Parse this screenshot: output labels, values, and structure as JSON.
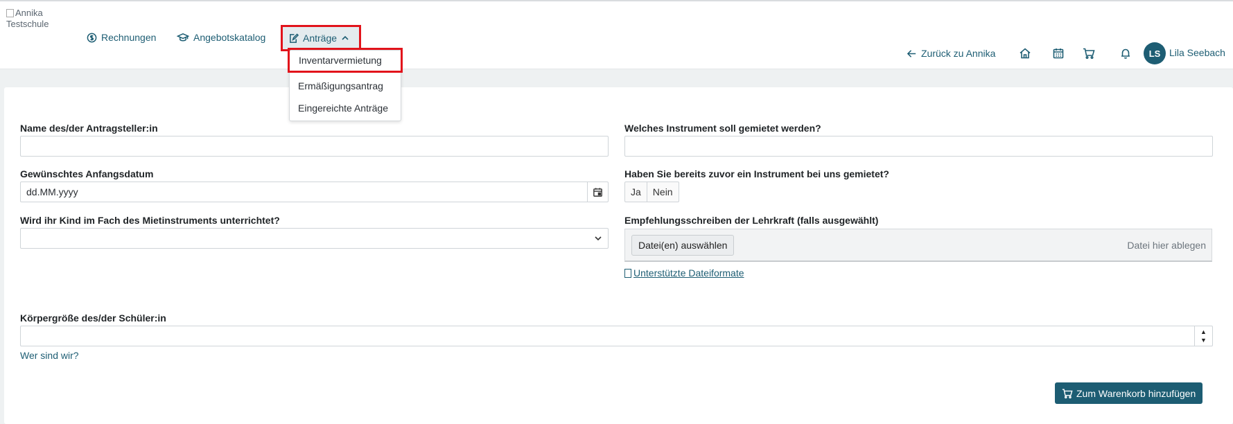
{
  "header": {
    "logo_alt": "Annika Testschule",
    "nav": [
      {
        "label": "Rechnungen",
        "icon": "dollar-circle-icon"
      },
      {
        "label": "Angebotskatalog",
        "icon": "graduation-cap-icon"
      },
      {
        "label": "Anträge",
        "icon": "edit-document-icon",
        "expanded": true
      }
    ],
    "back_label": "Zurück zu Annika",
    "icons": [
      "home-icon",
      "calendar-icon",
      "cart-icon",
      "bell-icon"
    ],
    "user": {
      "initials": "LS",
      "name": "Lila Seebach"
    }
  },
  "dropdown": {
    "items": [
      {
        "label": "Inventarvermietung",
        "selected": true
      },
      {
        "label": "Ermäßigungsantrag"
      },
      {
        "label": "Eingereichte Anträge"
      }
    ]
  },
  "form": {
    "name_label": "Name des/der Antragsteller:in",
    "name_value": "",
    "instrument_label": "Welches Instrument soll gemietet werden?",
    "instrument_value": "",
    "start_date_label": "Gewünschtes Anfangsdatum",
    "start_date_placeholder": "dd.MM.yyyy",
    "rented_before_label": "Haben Sie bereits zuvor ein Instrument bei uns gemietet?",
    "yes": "Ja",
    "no": "Nein",
    "taught_label": "Wird ihr Kind im Fach des Mietinstruments unterrichtet?",
    "taught_value": "",
    "recommendation_label": "Empfehlungsschreiben der Lehrkraft (falls ausgewählt)",
    "choose_files": "Datei(en) auswählen",
    "drop_hint": "Datei hier ablegen",
    "supported_formats": "Unterstützte Dateiformate",
    "height_label": "Körpergröße des/der Schüler:in",
    "height_value": "",
    "about_link": "Wer sind wir?",
    "add_to_cart": "Zum Warenkorb hinzufügen"
  },
  "colors": {
    "primary": "#1d5d73",
    "highlight": "#e2131b",
    "background": "#eef1f2"
  }
}
